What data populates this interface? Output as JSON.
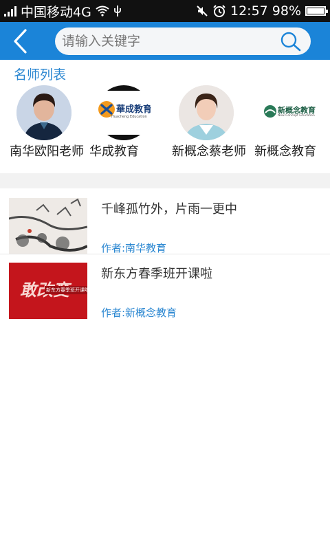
{
  "status_bar": {
    "carrier": "中国移动4G",
    "time": "12:57",
    "battery": "98%",
    "battery_level": 0.98
  },
  "header": {
    "search_placeholder": "请输入关键字",
    "back_icon": "chevron-left-icon",
    "search_icon": "search-icon",
    "accent_color": "#1b84d8"
  },
  "teachers_section": {
    "title": "名师列表",
    "teachers": [
      {
        "name": "南华欧阳老师",
        "avatar": "portrait-photo"
      },
      {
        "name": "华成教育",
        "avatar": "huacheng-logo",
        "logo_text": "華成教育",
        "logo_sub": "Huacheng Education"
      },
      {
        "name": "新概念蔡老师",
        "avatar": "portrait-photo"
      },
      {
        "name": "新概念教育",
        "avatar": "new-concept-logo",
        "logo_text": "新概念教育",
        "logo_sub": "New Concept Education"
      }
    ]
  },
  "articles": [
    {
      "title": "千峰孤竹外，片雨一更中",
      "author": "作者:南华教育",
      "thumb": "ink-painting"
    },
    {
      "title": "新东方春季班开课啦",
      "author": "作者:新概念教育",
      "thumb": "red-promo-banner",
      "thumb_text": "敢改变",
      "thumb_sub": "新东方春季班开课啦!"
    }
  ]
}
